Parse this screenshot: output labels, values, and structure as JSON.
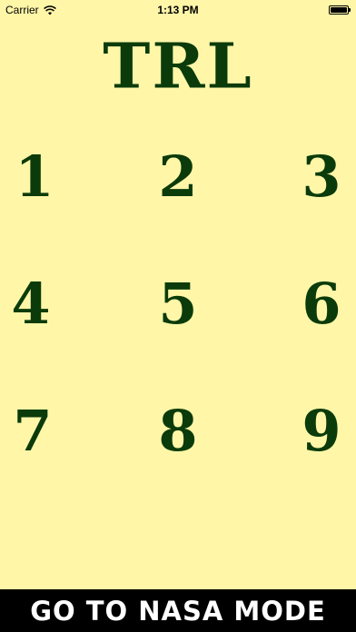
{
  "status_bar": {
    "carrier": "Carrier",
    "time": "1:13 PM"
  },
  "app": {
    "title": "TRL"
  },
  "keypad": {
    "keys": [
      "1",
      "2",
      "3",
      "4",
      "5",
      "6",
      "7",
      "8",
      "9"
    ]
  },
  "footer": {
    "mode_button_label": "GO TO NASA MODE"
  },
  "colors": {
    "background": "#fff6a8",
    "accent": "#0b3b0a",
    "footer_background": "#000000",
    "footer_text": "#ffffff"
  },
  "icons": {
    "wifi": "wifi-icon",
    "battery": "battery-icon"
  }
}
